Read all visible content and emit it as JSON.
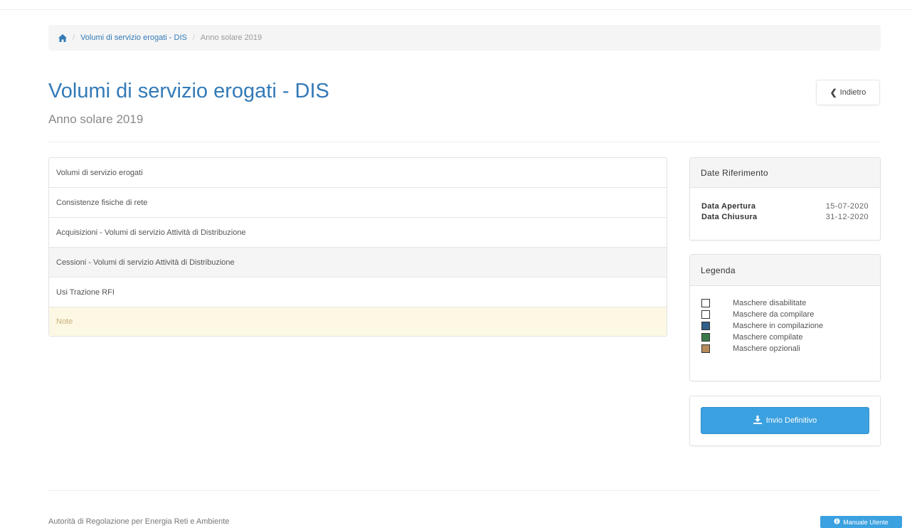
{
  "breadcrumb": {
    "home_icon": "home-icon",
    "link": "Volumi di servizio erogati - DIS",
    "current": "Anno solare 2019"
  },
  "header": {
    "title": "Volumi di servizio erogati - DIS",
    "subtitle": "Anno solare 2019",
    "back_label": "Indietro",
    "back_icon": "chevron-left-icon"
  },
  "masks": [
    {
      "label": "Volumi di servizio erogati"
    },
    {
      "label": "Consistenze fisiche di rete"
    },
    {
      "label": "Acquisizioni - Volumi di servizio Attività  di Distribuzione"
    },
    {
      "label": "Cessioni - Volumi di servizio Attività  di Distribuzione"
    },
    {
      "label": "Usi Trazione RFI"
    },
    {
      "label": "Note"
    }
  ],
  "dates": {
    "title": "Date Riferimento",
    "opening_label": "Data Apertura",
    "opening_value": "15-07-2020",
    "closing_label": "Data Chiusura",
    "closing_value": "31-12-2020"
  },
  "legend": {
    "title": "Legenda",
    "items": [
      {
        "label": "Maschere disabilitate",
        "color": "#ffffff"
      },
      {
        "label": "Maschere da compilare",
        "color": "#ffffff"
      },
      {
        "label": "Maschere in compilazione",
        "color": "#2f5f8a"
      },
      {
        "label": "Maschere compilate",
        "color": "#3d7a4a"
      },
      {
        "label": "Maschere opzionali",
        "color": "#b88a5a"
      }
    ]
  },
  "actions": {
    "final_submit_label": "Invio Definitivo",
    "final_submit_icon": "download-icon"
  },
  "footer": {
    "authority": "Autorità di Regolazione per Energia Reti e Ambiente",
    "manual_label": "Manuale Utente",
    "manual_icon": "info-circle-icon"
  },
  "colors": {
    "accent": "#337ab7",
    "button": "#3ba1e0",
    "note_bg": "#fcf8e3"
  }
}
